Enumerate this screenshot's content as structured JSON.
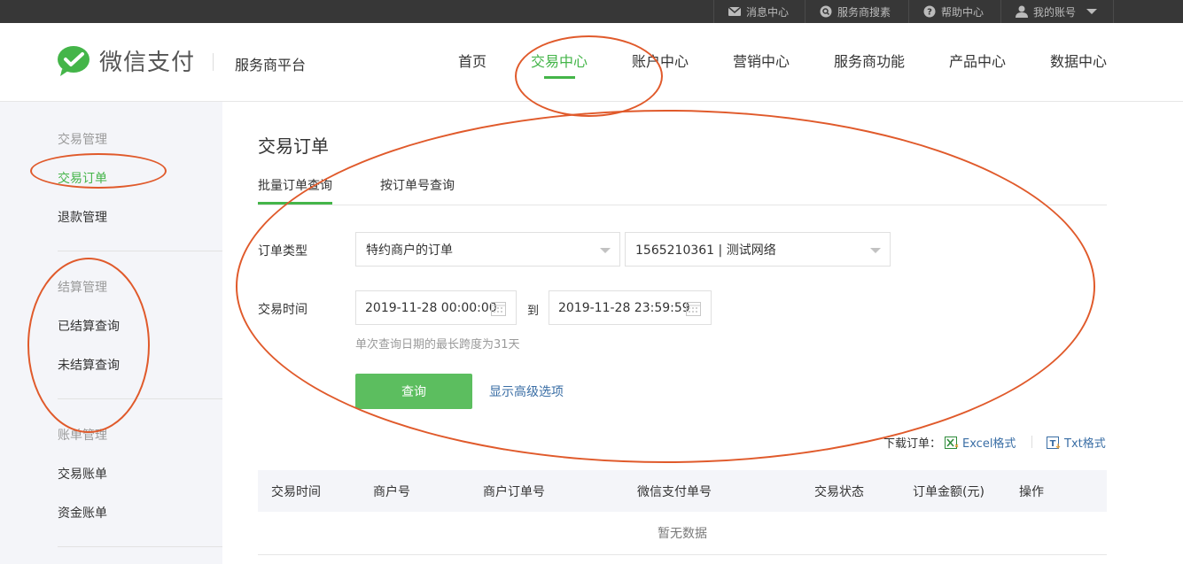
{
  "topbar": {
    "items": [
      {
        "label": "消息中心",
        "icon": "message-icon"
      },
      {
        "label": "服务商搜素",
        "icon": "search-icon"
      },
      {
        "label": "帮助中心",
        "icon": "help-icon"
      },
      {
        "label": "我的账号",
        "icon": "user-icon"
      }
    ]
  },
  "header": {
    "logo_text": "微信支付",
    "platform": "服务商平台",
    "nav": [
      {
        "label": "首页"
      },
      {
        "label": "交易中心"
      },
      {
        "label": "账户中心"
      },
      {
        "label": "营销中心"
      },
      {
        "label": "服务商功能"
      },
      {
        "label": "产品中心"
      },
      {
        "label": "数据中心"
      }
    ]
  },
  "sidebar": {
    "groups": [
      {
        "title": "交易管理",
        "items": [
          "交易订单",
          "退款管理"
        ]
      },
      {
        "title": "结算管理",
        "items": [
          "已结算查询",
          "未结算查询"
        ]
      },
      {
        "title": "账单管理",
        "items": [
          "交易账单",
          "资金账单"
        ]
      }
    ]
  },
  "main": {
    "title": "交易订单",
    "tabs": [
      "批量订单查询",
      "按订单号查询"
    ],
    "order_type_label": "订单类型",
    "order_type_value": "特约商户的订单",
    "merchant_value": "1565210361 | 测试网络",
    "time_label": "交易时间",
    "start_time": "2019-11-28 00:00:00",
    "to_label": "到",
    "end_time": "2019-11-28 23:59:59",
    "hint": "单次查询日期的最长跨度为31天",
    "query_button": "查询",
    "advanced_link": "显示高级选项",
    "download_label": "下载订单：",
    "excel_link": "Excel格式",
    "txt_link": "Txt格式",
    "table_headers": [
      "交易时间",
      "商户号",
      "商户订单号",
      "微信支付单号",
      "交易状态",
      "订单金额(元)",
      "操作"
    ],
    "empty_text": "暂无数据"
  },
  "colors": {
    "accent": "#44b549",
    "button": "#5cbe5f",
    "link": "#3a6ea5",
    "annotation": "#e05a2b"
  }
}
